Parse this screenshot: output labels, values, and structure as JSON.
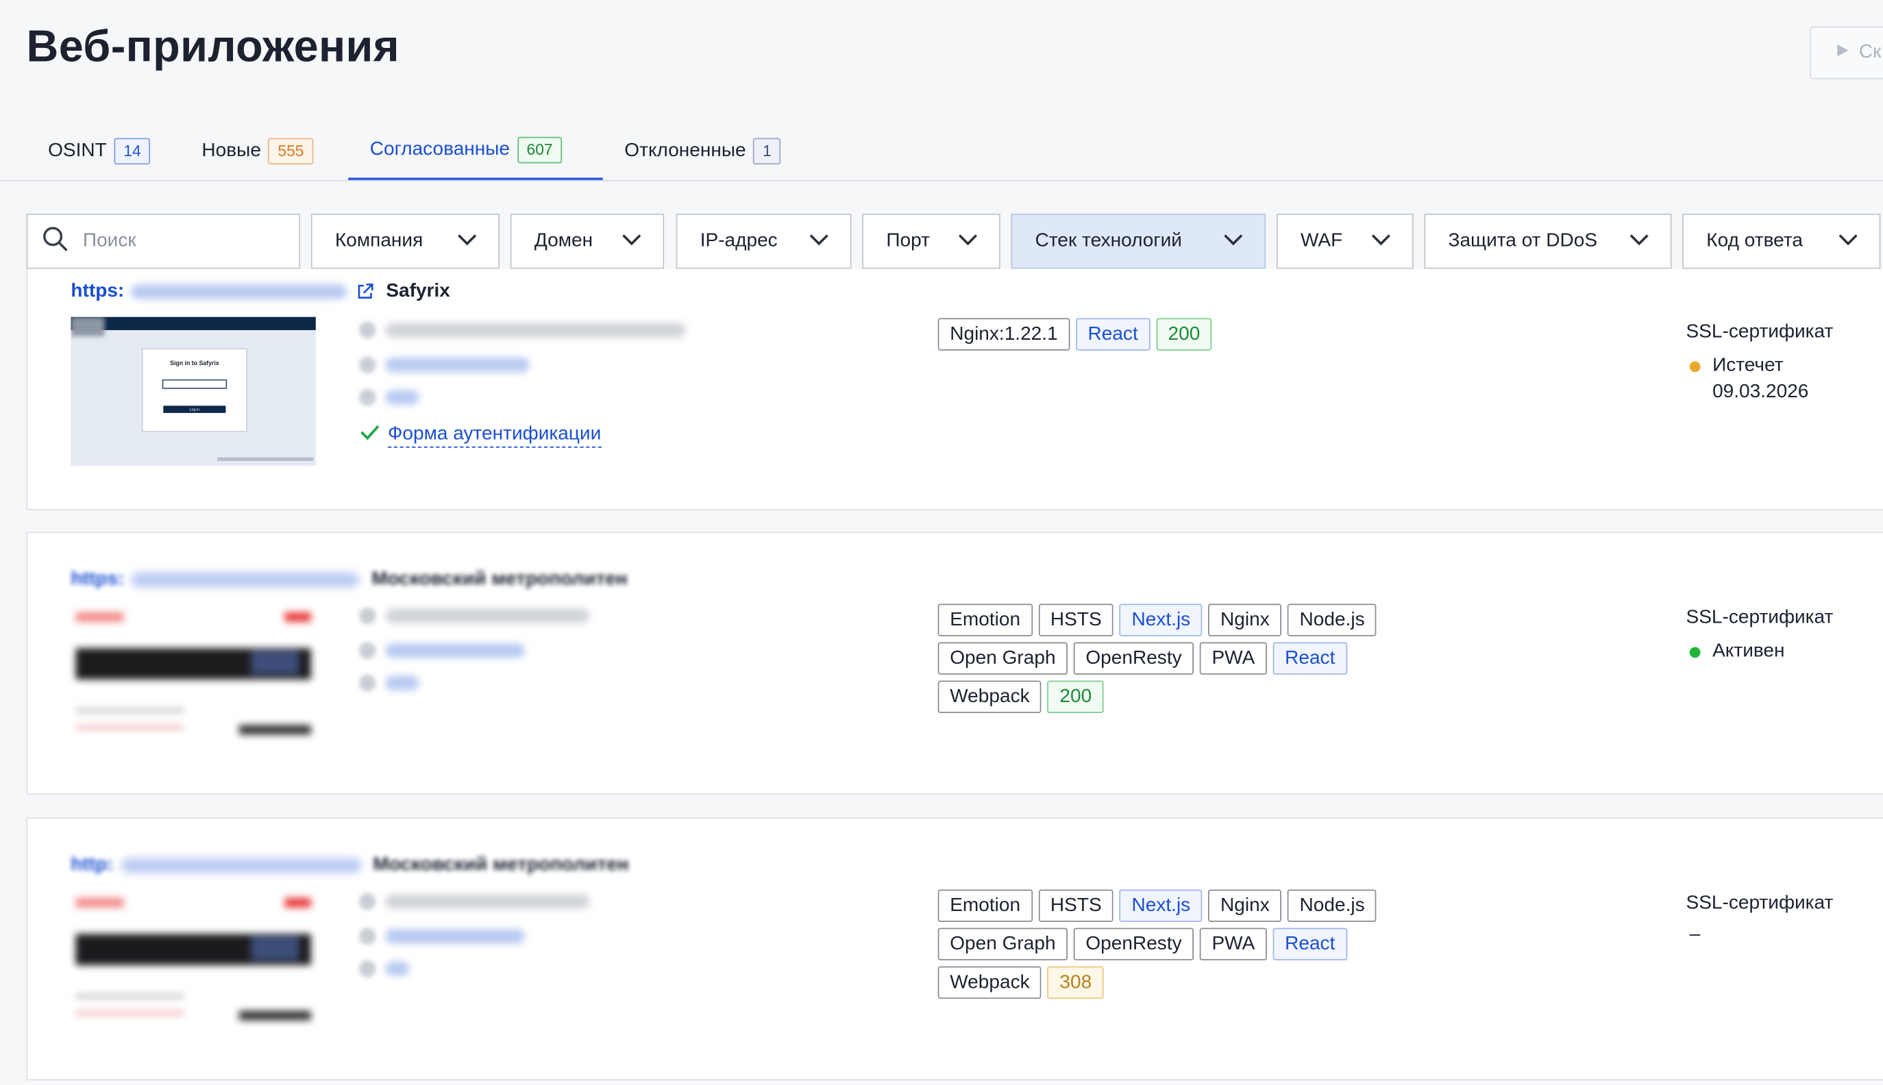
{
  "page": {
    "title": "Веб-приложения",
    "top_button_label": "Ск"
  },
  "tabs": [
    {
      "label": "OSINT",
      "count": "14"
    },
    {
      "label": "Новые",
      "count": "555"
    },
    {
      "label": "Согласованные",
      "count": "607",
      "active": true
    },
    {
      "label": "Отклоненные",
      "count": "1"
    }
  ],
  "filters": {
    "search_placeholder": "Поиск",
    "buttons": [
      "Компания",
      "Домен",
      "IP-адрес",
      "Порт",
      "Стек технологий",
      "WAF",
      "Защита от DDoS",
      "Код ответа"
    ],
    "selected": "Стек технологий"
  },
  "apps": [
    {
      "scheme": "https:",
      "company": "Safyrix",
      "thumb_title": "Sign in to Safyrix",
      "thumb_button": "Log in",
      "auth_form_label": "Форма аутентификации",
      "tags": [
        {
          "text": "Nginx:1.22.1",
          "style": "default"
        },
        {
          "text": "React",
          "style": "blue"
        },
        {
          "text": "200",
          "style": "green"
        }
      ],
      "ssl_title": "SSL-сертификат",
      "ssl_status": "Истечет 09.03.2026",
      "ssl_color": "#e8a92a"
    },
    {
      "scheme": "https:",
      "company": "Московский метрополитен",
      "tags": [
        {
          "text": "Emotion",
          "style": "default"
        },
        {
          "text": "HSTS",
          "style": "default"
        },
        {
          "text": "Next.js",
          "style": "blue"
        },
        {
          "text": "Nginx",
          "style": "default"
        },
        {
          "text": "Node.js",
          "style": "default"
        },
        {
          "text": "Open Graph",
          "style": "default"
        },
        {
          "text": "OpenResty",
          "style": "default"
        },
        {
          "text": "PWA",
          "style": "default"
        },
        {
          "text": "React",
          "style": "blue"
        },
        {
          "text": "Webpack",
          "style": "default"
        },
        {
          "text": "200",
          "style": "green"
        }
      ],
      "ssl_title": "SSL-сертификат",
      "ssl_status": "Активен",
      "ssl_color": "#1fb53a"
    },
    {
      "scheme": "http:",
      "company": "Московский метрополитен",
      "tags": [
        {
          "text": "Emotion",
          "style": "default"
        },
        {
          "text": "HSTS",
          "style": "default"
        },
        {
          "text": "Next.js",
          "style": "blue"
        },
        {
          "text": "Nginx",
          "style": "default"
        },
        {
          "text": "Node.js",
          "style": "default"
        },
        {
          "text": "Open Graph",
          "style": "default"
        },
        {
          "text": "OpenResty",
          "style": "default"
        },
        {
          "text": "PWA",
          "style": "default"
        },
        {
          "text": "React",
          "style": "blue"
        },
        {
          "text": "Webpack",
          "style": "default"
        },
        {
          "text": "308",
          "style": "amber"
        }
      ],
      "ssl_title": "SSL-сертификат",
      "ssl_status": "–",
      "ssl_color": ""
    }
  ],
  "colors": {
    "accent": "#1a4fd1",
    "selected_filter_bg": "#dfe8f8",
    "check": "#1fa84a"
  },
  "icons": [
    "search-icon",
    "chevron-down-icon",
    "external-link-icon",
    "check-icon",
    "play-icon",
    "building-icon",
    "globe-icon",
    "user-icon"
  ]
}
